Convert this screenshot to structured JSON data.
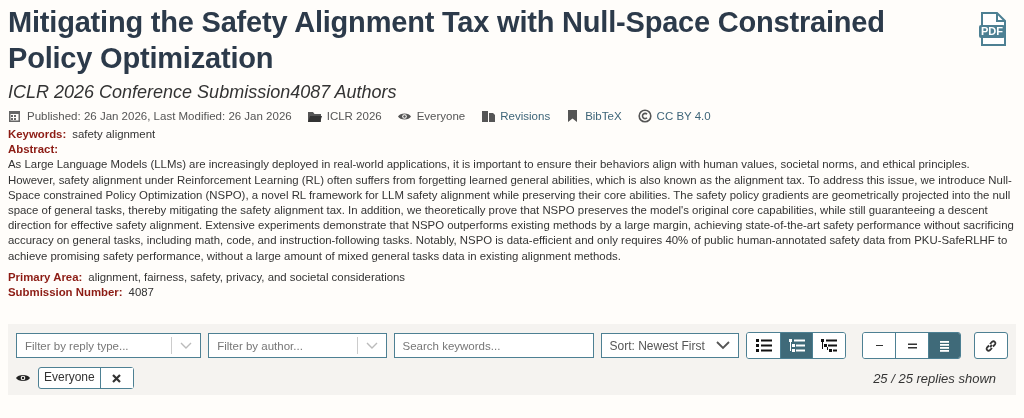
{
  "title": "Mitigating the Safety Alignment Tax with Null-Space Constrained Policy Optimization",
  "pdf_label": "PDF",
  "venue_line": "ICLR 2026 Conference Submission4087 Authors",
  "meta": [
    {
      "kind": "date",
      "text": "Published: 26 Jan 2026, Last Modified: 26 Jan 2026",
      "link": false
    },
    {
      "kind": "folder",
      "text": "ICLR 2026",
      "link": false
    },
    {
      "kind": "eye",
      "text": "Everyone",
      "link": false
    },
    {
      "kind": "revisions",
      "text": "Revisions",
      "link": true
    },
    {
      "kind": "bookmark",
      "text": "BibTeX",
      "link": true
    },
    {
      "kind": "license",
      "text": "CC BY 4.0",
      "link": true
    }
  ],
  "fields": [
    {
      "kind": "inline",
      "label": "Keywords:",
      "value": "safety alignment"
    },
    {
      "kind": "block",
      "label": "Abstract:",
      "value": "As Large Language Models (LLMs) are increasingly deployed in real-world applications, it is important to ensure their behaviors align with human values, societal norms, and ethical principles. However, safety alignment under Reinforcement Learning (RL) often suffers from forgetting learned general abilities, which is also known as the alignment tax. To address this issue, we introduce Null-Space constrained Policy Optimization (NSPO), a novel RL framework for LLM safety alignment while preserving their core abilities. The safety policy gradients are geometrically projected into the null space of general tasks, thereby mitigating the safety alignment tax. In addition, we theoretically prove that NSPO preserves the model's original core capabilities, while still guaranteeing a descent direction for effective safety alignment. Extensive experiments demonstrate that NSPO outperforms existing methods by a large margin, achieving state-of-the-art safety performance without sacrificing accuracy on general tasks, including math, code, and instruction-following tasks. Notably, NSPO is data-efficient and only requires 40% of public human-annotated safety data from PKU-SafeRLHF to achieve promising safety performance, without a large amount of mixed general tasks data in existing alignment methods."
    },
    {
      "kind": "inline",
      "label": "Primary Area:",
      "value": "alignment, fairness, safety, privacy, and societal considerations"
    },
    {
      "kind": "inline",
      "label": "Submission Number:",
      "value": "4087"
    }
  ],
  "filters": {
    "reply_type": {
      "placeholder": "Filter by reply type..."
    },
    "author": {
      "placeholder": "Filter by author..."
    },
    "keywords": {
      "placeholder": "Search keywords..."
    },
    "sort": {
      "value": "Sort: Newest First"
    },
    "layout_buttons": [
      {
        "kind": "flat",
        "selected": false
      },
      {
        "kind": "threaded",
        "selected": true
      },
      {
        "kind": "nested",
        "selected": false
      }
    ],
    "density_buttons": [
      {
        "kind": "collapsed",
        "selected": false
      },
      {
        "kind": "default",
        "selected": false
      },
      {
        "kind": "expanded",
        "selected": true
      }
    ],
    "visibility_tag": "Everyone",
    "count": "25 / 25 replies shown"
  }
}
